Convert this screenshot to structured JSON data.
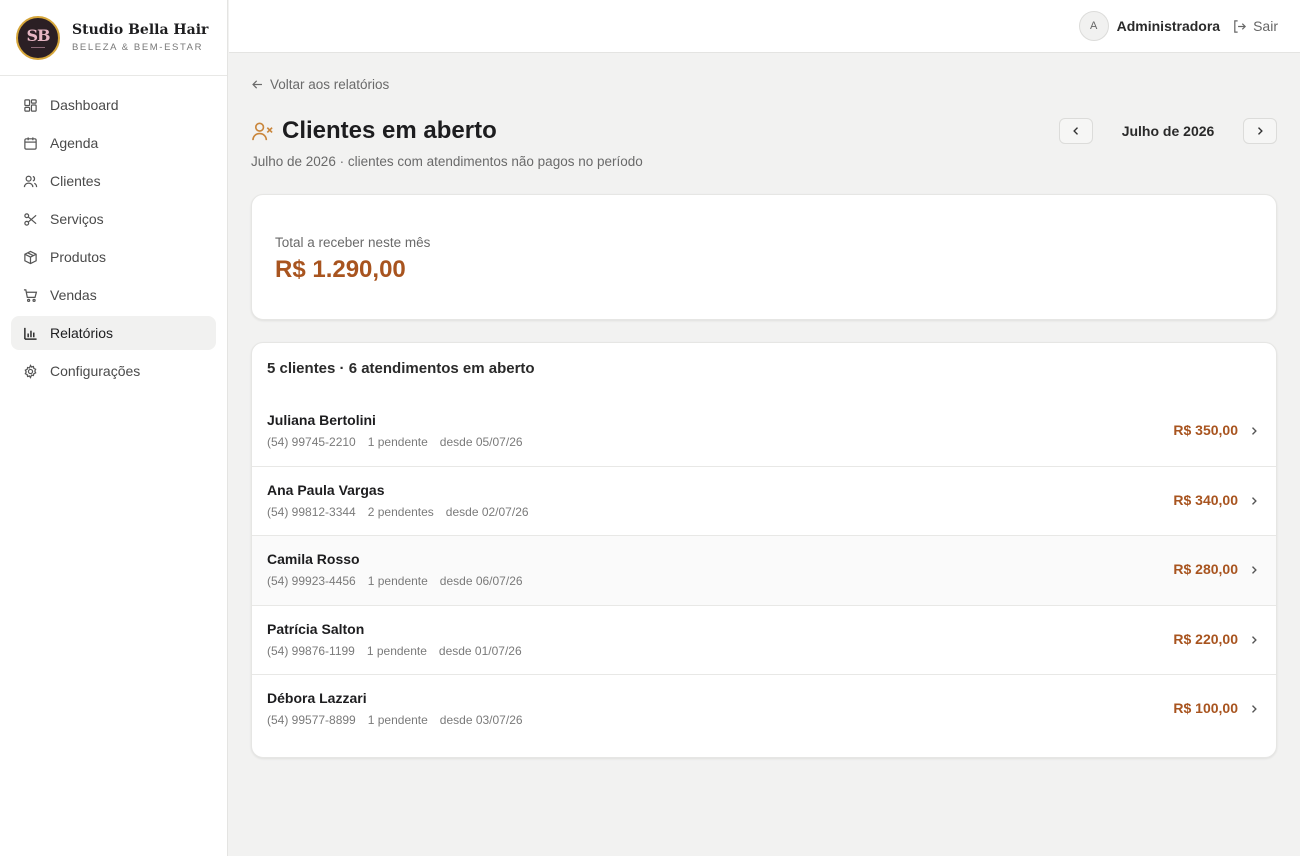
{
  "brand": {
    "logo_initials": "SB",
    "name": "Studio Bella Hair",
    "tagline": "BELEZA & BEM-ESTAR"
  },
  "sidebar": {
    "items": [
      {
        "label": "Dashboard",
        "icon": "dashboard-icon"
      },
      {
        "label": "Agenda",
        "icon": "calendar-icon"
      },
      {
        "label": "Clientes",
        "icon": "users-icon"
      },
      {
        "label": "Serviços",
        "icon": "scissors-icon"
      },
      {
        "label": "Produtos",
        "icon": "package-icon"
      },
      {
        "label": "Vendas",
        "icon": "cart-icon"
      },
      {
        "label": "Relatórios",
        "icon": "bar-chart-icon",
        "active": true
      },
      {
        "label": "Configurações",
        "icon": "gear-icon"
      }
    ]
  },
  "topbar": {
    "avatar_initial": "A",
    "user_name": "Administradora",
    "logout_label": "Sair"
  },
  "page": {
    "back_label": "Voltar aos relatórios",
    "title": "Clientes em aberto",
    "subtitle": "Julho de 2026 · clientes com atendimentos não pagos no período",
    "month_label": "Julho de 2026"
  },
  "summary": {
    "label": "Total a receber neste mês",
    "value": "R$ 1.290,00"
  },
  "list": {
    "header": "5 clientes · 6 atendimentos em aberto",
    "rows": [
      {
        "name": "Juliana Bertolini",
        "phone": "(54) 99745-2210",
        "pending": "1 pendente",
        "since": "desde 05/07/26",
        "amount": "R$ 350,00"
      },
      {
        "name": "Ana Paula Vargas",
        "phone": "(54) 99812-3344",
        "pending": "2 pendentes",
        "since": "desde 02/07/26",
        "amount": "R$ 340,00"
      },
      {
        "name": "Camila Rosso",
        "phone": "(54) 99923-4456",
        "pending": "1 pendente",
        "since": "desde 06/07/26",
        "amount": "R$ 280,00"
      },
      {
        "name": "Patrícia Salton",
        "phone": "(54) 99876-1199",
        "pending": "1 pendente",
        "since": "desde 01/07/26",
        "amount": "R$ 220,00"
      },
      {
        "name": "Débora Lazzari",
        "phone": "(54) 99577-8899",
        "pending": "1 pendente",
        "since": "desde 03/07/26",
        "amount": "R$ 100,00"
      }
    ]
  },
  "colors": {
    "accent_amount": "#a8541f",
    "logo_gold": "#d6a63a",
    "icon_accent": "#c9853a"
  }
}
